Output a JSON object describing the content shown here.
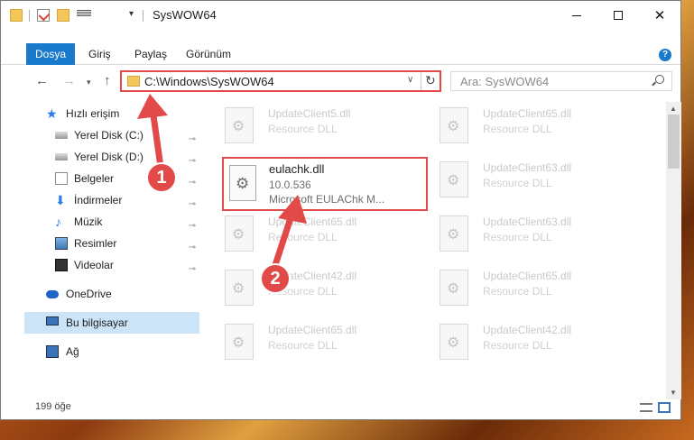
{
  "window": {
    "title": "SysWOW64",
    "dropdown_glyph": "▾",
    "minimize_label": "",
    "close_glyph": "✕"
  },
  "ribbon": {
    "tabs": [
      "Dosya",
      "Giriş",
      "Paylaş",
      "Görünüm"
    ],
    "help": "?"
  },
  "navigation": {
    "back": "←",
    "forward": "→",
    "recent": "▾",
    "up": "↑"
  },
  "address_bar": {
    "path": "C:\\Windows\\SysWOW64",
    "chevron": "∨",
    "refresh": "↻"
  },
  "search": {
    "placeholder": "Ara: SysWOW64"
  },
  "sidebar": {
    "items": [
      {
        "label": "Hızlı erişim",
        "icon": "star-icon"
      },
      {
        "label": "Yerel Disk (C:)",
        "icon": "disk-icon",
        "pinned": true
      },
      {
        "label": "Yerel Disk (D:)",
        "icon": "disk-icon",
        "pinned": true
      },
      {
        "label": "Belgeler",
        "icon": "documents-icon",
        "pinned": true
      },
      {
        "label": "İndirmeler",
        "icon": "downloads-icon",
        "pinned": true
      },
      {
        "label": "Müzik",
        "icon": "music-icon",
        "pinned": true
      },
      {
        "label": "Resimler",
        "icon": "pictures-icon",
        "pinned": true
      },
      {
        "label": "Videolar",
        "icon": "videos-icon",
        "pinned": true
      },
      {
        "label": "OneDrive",
        "icon": "onedrive-icon"
      },
      {
        "label": "Bu bilgisayar",
        "icon": "computer-icon",
        "selected": true
      },
      {
        "label": "Ağ",
        "icon": "network-icon"
      }
    ],
    "pin_glyph": "📌"
  },
  "files": {
    "left_column": [
      {
        "name": "UpdateClient5.dll",
        "desc": "Resource DLL"
      },
      {
        "name": "UpdateClient65.dll",
        "desc": "Resource DLL"
      },
      {
        "name": "UpdateClient42.dll",
        "desc": "Resource DLL"
      },
      {
        "name": "UpdateClient65.dll",
        "desc": "Resource DLL"
      }
    ],
    "right_column": [
      {
        "name": "UpdateClient65.dll",
        "desc": "Resource DLL"
      },
      {
        "name": "UpdateClient63.dll",
        "desc": "Resource DLL"
      },
      {
        "name": "UpdateClient63.dll",
        "desc": "Resource DLL"
      },
      {
        "name": "UpdateClient65.dll",
        "desc": "Resource DLL"
      },
      {
        "name": "UpdateClient42.dll",
        "desc": "Resource DLL"
      }
    ],
    "highlighted": {
      "name": "eulachk.dll",
      "version": "10.0.536",
      "description": "Microsoft EULAChk M..."
    }
  },
  "status_bar": {
    "count": "199 öğe"
  },
  "callouts": {
    "badge_1": "1",
    "badge_2": "2",
    "color": "#e24949"
  }
}
